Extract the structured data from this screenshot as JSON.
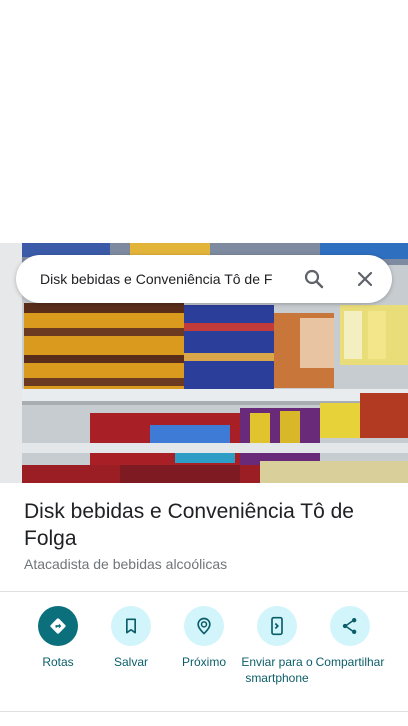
{
  "search": {
    "query": "Disk bebidas e Conveniência Tô de F"
  },
  "place": {
    "name": "Disk bebidas e Conveniência Tô de Folga",
    "category": "Atacadista de bebidas alcoólicas"
  },
  "actions": [
    {
      "label": "Rotas",
      "icon": "directions-icon"
    },
    {
      "label": "Salvar",
      "icon": "bookmark-icon"
    },
    {
      "label": "Próximo",
      "icon": "nearby-icon"
    },
    {
      "label": "Enviar para o smartphone",
      "icon": "send-to-phone-icon"
    },
    {
      "label": "Compartilhar",
      "icon": "share-icon"
    }
  ],
  "colors": {
    "accent": "#0b6f7c",
    "action_bg": "#d2f4fb",
    "action_text": "#0b5e69",
    "title": "#202124",
    "subtitle": "#70757a"
  }
}
